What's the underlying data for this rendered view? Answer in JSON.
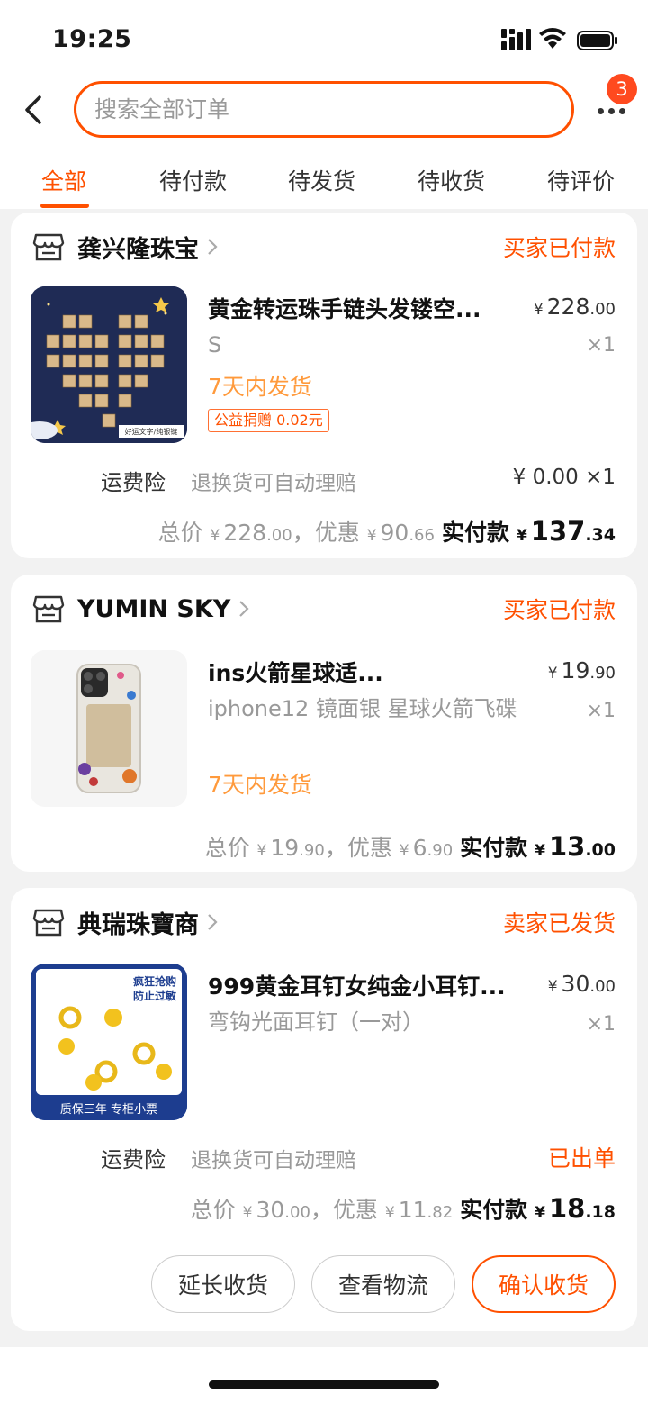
{
  "status_bar": {
    "time": "19:25"
  },
  "search": {
    "placeholder": "搜索全部订单"
  },
  "more": {
    "badge_count": "3"
  },
  "tabs": [
    {
      "label": "全部",
      "active": true
    },
    {
      "label": "待付款"
    },
    {
      "label": "待发货"
    },
    {
      "label": "待收货"
    },
    {
      "label": "待评价"
    }
  ],
  "orders": [
    {
      "shop": "龚兴隆珠宝",
      "status": "买家已付款",
      "item": {
        "title": "黄金转运珠手链头发镂空...",
        "price_int": "228",
        "price_dec": ".00",
        "sku": "S",
        "qty": "×1",
        "ship": "7天内发货",
        "donation": "公益捐赠 0.02元",
        "image_icon": "letter-tiles-bracelet-image",
        "image_caption": "好运文字/纯银链"
      },
      "insurance": {
        "label": "运费险",
        "desc": "退换货可自动理赔",
        "right": "¥ 0.00 ×1"
      },
      "summary": {
        "total_label": "总价",
        "total_int": "228",
        "total_dec": ".00",
        "discount_label": "，优惠",
        "discount_int": "90",
        "discount_dec": ".66",
        "pay_label": "实付款",
        "pay_int": "137",
        "pay_dec": ".34"
      }
    },
    {
      "shop": "YUMIN SKY",
      "status": "买家已付款",
      "item": {
        "title": "ins火箭星球适...",
        "price_int": "19",
        "price_dec": ".90",
        "sku": "iphone12 镜面银 星球火箭飞碟",
        "qty": "×1",
        "ship": "7天内发货",
        "image_icon": "phone-case-image"
      },
      "summary": {
        "total_label": "总价",
        "total_int": "19",
        "total_dec": ".90",
        "discount_label": "，优惠",
        "discount_int": "6",
        "discount_dec": ".90",
        "pay_label": "实付款",
        "pay_int": "13",
        "pay_dec": ".00"
      }
    },
    {
      "shop": "典瑞珠寶商",
      "status": "卖家已发货",
      "item": {
        "title": "999黄金耳钉女纯金小耳钉...",
        "price_int": "30",
        "price_dec": ".00",
        "sku": "弯钩光面耳钉（一对）",
        "qty": "×1",
        "image_icon": "gold-earrings-image",
        "image_tag_top": "疯狂抢购\n防止过敏",
        "image_tag_bottom": "质保三年   专柜小票"
      },
      "insurance": {
        "label": "运费险",
        "desc": "退换货可自动理赔",
        "right": "已出单"
      },
      "summary": {
        "total_label": "总价",
        "total_int": "30",
        "total_dec": ".00",
        "discount_label": "，优惠",
        "discount_int": "11",
        "discount_dec": ".82",
        "pay_label": "实付款",
        "pay_int": "18",
        "pay_dec": ".18"
      },
      "buttons": [
        "延长收货",
        "查看物流",
        "确认收货"
      ]
    }
  ],
  "currency": "¥",
  "colors": {
    "accent": "#ff5000",
    "ship": "#ff9a3c",
    "muted": "#999999",
    "background": "#f2f2f2"
  }
}
